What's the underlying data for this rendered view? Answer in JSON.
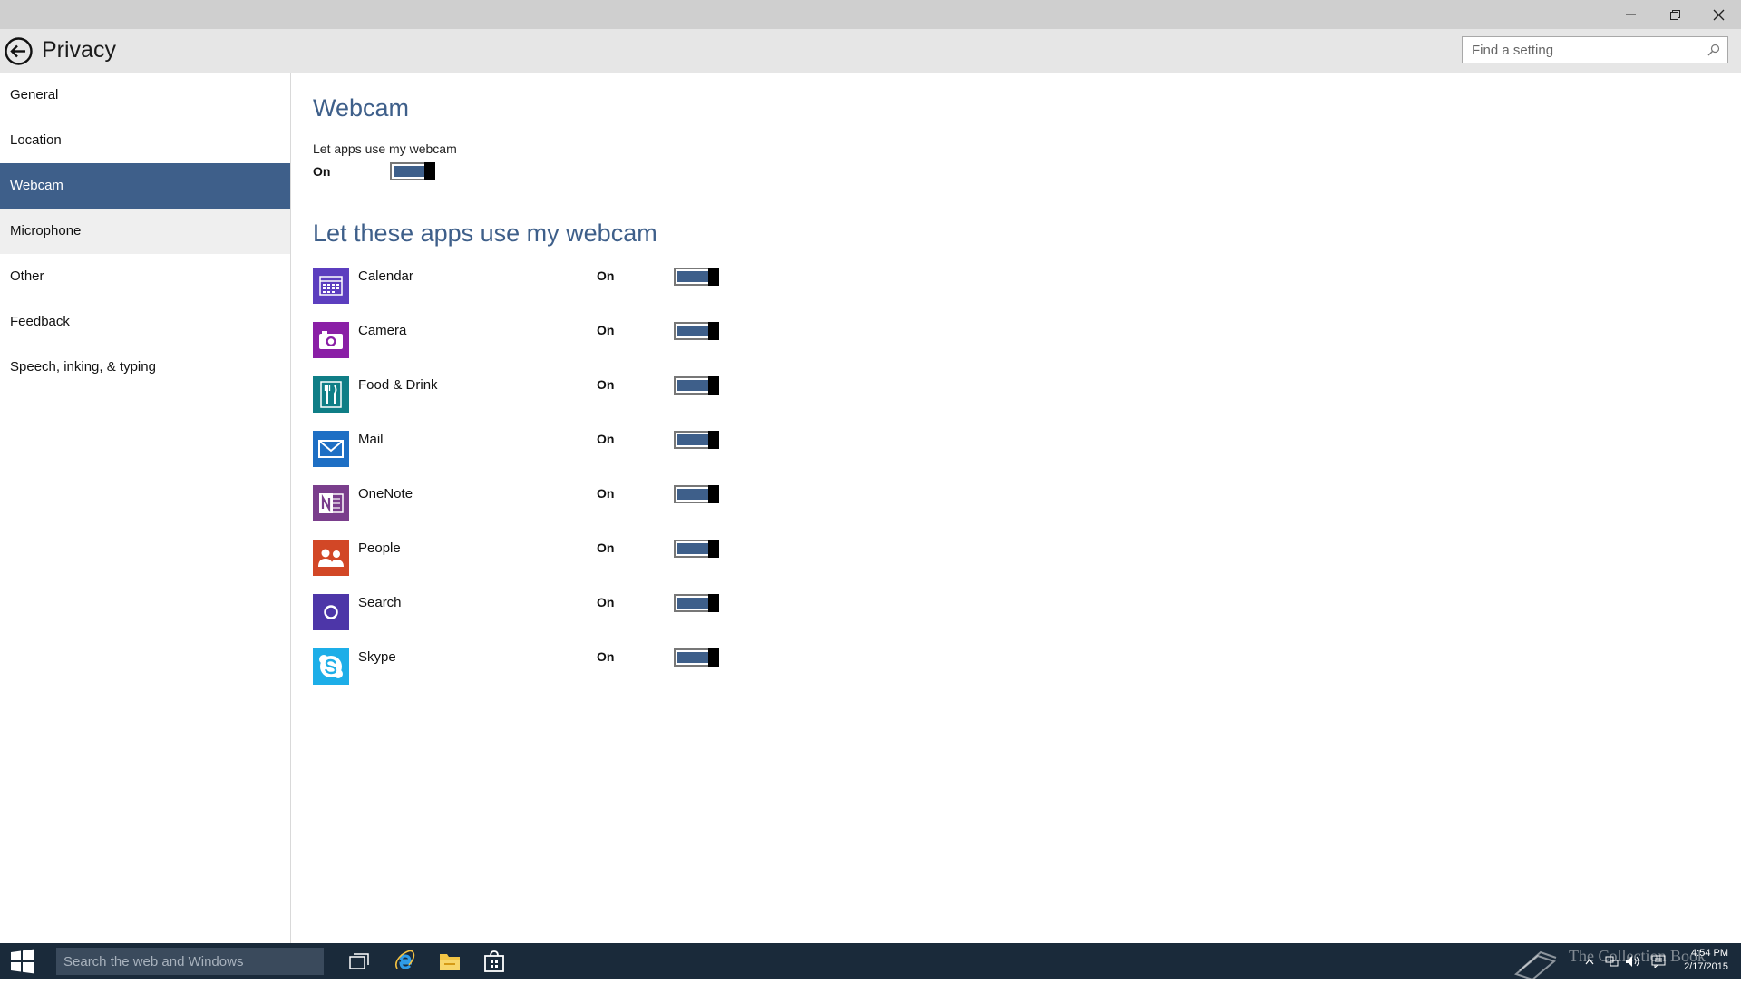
{
  "window": {
    "controls": {
      "minimize_icon": "minimize-icon",
      "restore_icon": "restore-icon",
      "close_icon": "close-icon"
    }
  },
  "header": {
    "title": "Privacy",
    "search_placeholder": "Find a setting"
  },
  "sidebar": {
    "items": [
      {
        "label": "General"
      },
      {
        "label": "Location"
      },
      {
        "label": "Webcam",
        "selected": true
      },
      {
        "label": "Microphone"
      },
      {
        "label": "Other"
      },
      {
        "label": "Feedback"
      },
      {
        "label": "Speech, inking, & typing"
      }
    ]
  },
  "main": {
    "title": "Webcam",
    "master_toggle": {
      "label": "Let apps use my webcam",
      "state": "On",
      "on": true
    },
    "apps_heading": "Let these apps use my webcam",
    "apps": [
      {
        "name": "Calendar",
        "state": "On",
        "on": true,
        "icon": "calendar-icon",
        "color": "#5c3ebf"
      },
      {
        "name": "Camera",
        "state": "On",
        "on": true,
        "icon": "camera-icon",
        "color": "#8a1fa6"
      },
      {
        "name": "Food & Drink",
        "state": "On",
        "on": true,
        "icon": "food-drink-icon",
        "color": "#0f7e86"
      },
      {
        "name": "Mail",
        "state": "On",
        "on": true,
        "icon": "mail-icon",
        "color": "#1e6fc4"
      },
      {
        "name": "OneNote",
        "state": "On",
        "on": true,
        "icon": "onenote-icon",
        "color": "#7a3e8c"
      },
      {
        "name": "People",
        "state": "On",
        "on": true,
        "icon": "people-icon",
        "color": "#d24726"
      },
      {
        "name": "Search",
        "state": "On",
        "on": true,
        "icon": "search-app-icon",
        "color": "#4d36a8"
      },
      {
        "name": "Skype",
        "state": "On",
        "on": true,
        "icon": "skype-icon",
        "color": "#1daee8"
      }
    ]
  },
  "taskbar": {
    "search_placeholder": "Search the web and Windows",
    "watermark": "The Collection Book",
    "clock_time": "4:54 PM",
    "clock_date": "2/17/2015"
  },
  "colors": {
    "accent": "#3e5f8a",
    "taskbar": "#1a2a3a",
    "header": "#e6e6e6",
    "titlebar": "#cfcfcf"
  }
}
